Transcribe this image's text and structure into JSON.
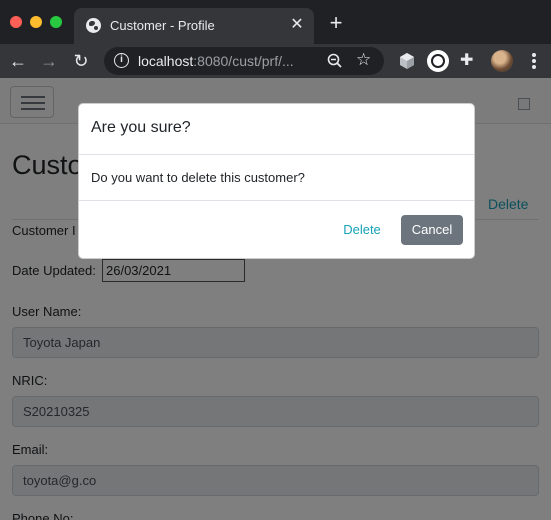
{
  "browser": {
    "tab_title": "Customer - Profile",
    "tab_close": "✕",
    "new_tab": "+",
    "url_host": "localhost",
    "url_path": ":8080/cust/prf/..."
  },
  "page": {
    "title": "Custo",
    "delete_link": "Delete",
    "customer_id_label": "Customer I",
    "date_updated_label": "Date Updated:",
    "date_updated_value": "26/03/2021",
    "user_name_label": "User Name:",
    "user_name_value": "Toyota Japan",
    "nric_label": "NRIC:",
    "nric_value": "S20210325",
    "email_label": "Email:",
    "email_value": "toyota@g.co",
    "phone_label": "Phone No:"
  },
  "modal": {
    "title": "Are you sure?",
    "body": "Do you want to delete this customer?",
    "delete_button": "Delete",
    "cancel_button": "Cancel"
  },
  "colors": {
    "accent_link": "#17a2b8",
    "cancel_button": "#6c757d"
  }
}
